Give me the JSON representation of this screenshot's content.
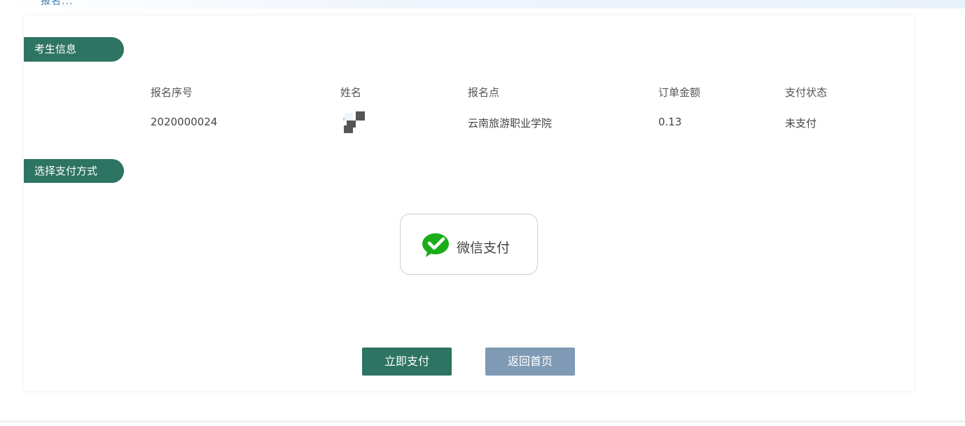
{
  "header": {
    "cut_title": "报名..."
  },
  "sections": {
    "candient_info_title": "考生信息",
    "payment_method_title": "选择支付方式"
  },
  "table": {
    "headers": [
      "报名序号",
      "姓名",
      "报名点",
      "订单金额",
      "支付状态"
    ],
    "row": {
      "serial": "2020000024",
      "name_icon": "pixelated-avatar-icon",
      "site": "云南旅游职业学院",
      "amount": "0.13",
      "status": "未支付"
    }
  },
  "payment": {
    "wechat_label": "微信支付",
    "wechat_icon": "wechat-icon",
    "wechat_color": "#1aad19"
  },
  "buttons": {
    "pay_now": "立即支付",
    "back_home": "返回首页"
  },
  "colors": {
    "primary": "#2e7462",
    "secondary": "#7f9ab5"
  }
}
